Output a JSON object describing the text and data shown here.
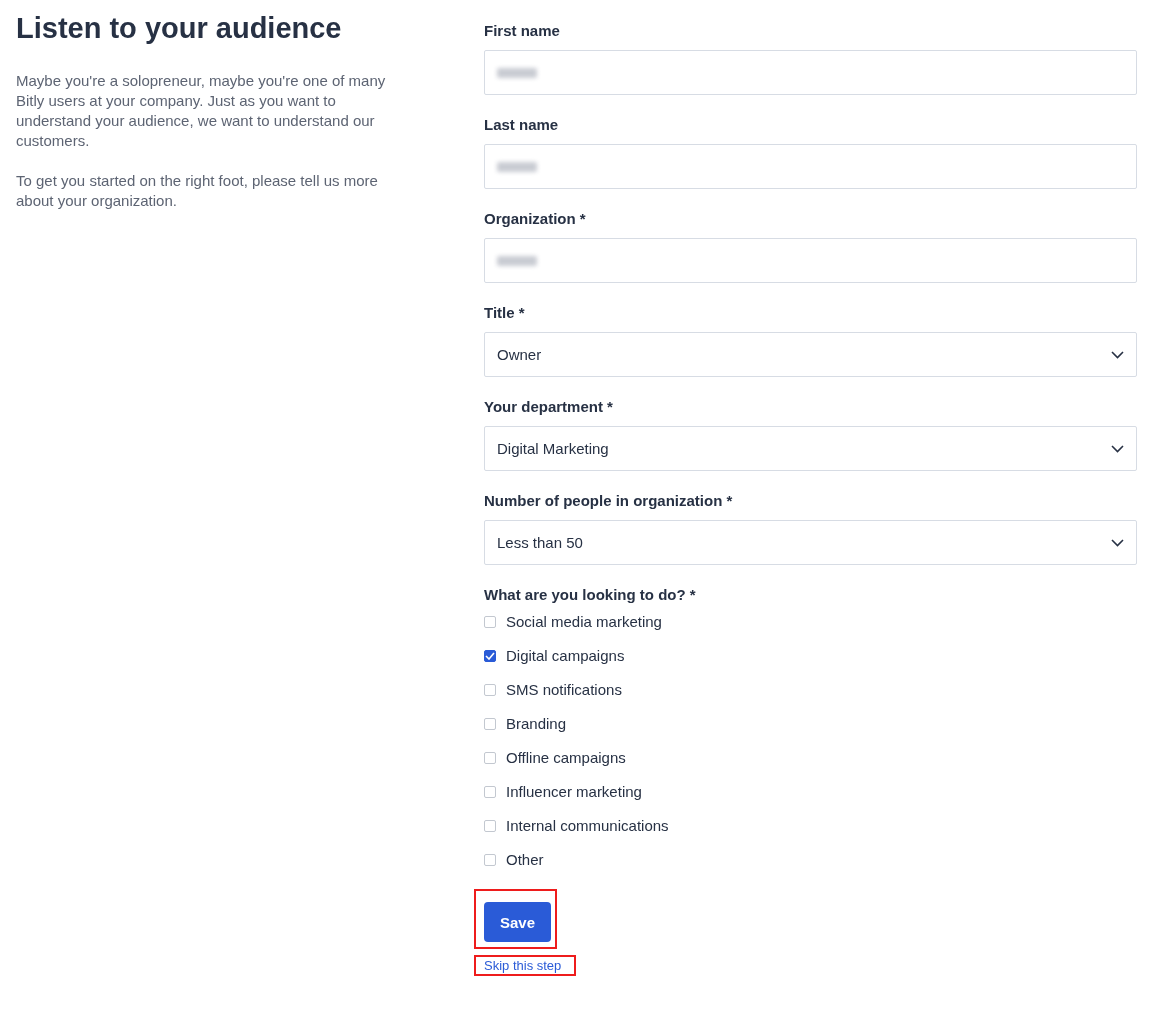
{
  "intro": {
    "title": "Listen to your audience",
    "paragraphs": [
      "Maybe you're a solopreneur, maybe you're one of many Bitly users at your company. Just as you want to understand your audience, we want to understand our customers.",
      "To get you started on the right foot, please tell us more about your organization."
    ]
  },
  "fields": [
    {
      "kind": "text",
      "label": "First name",
      "blurred": true
    },
    {
      "kind": "text",
      "label": "Last name",
      "blurred": true
    },
    {
      "kind": "text",
      "label": "Organization *",
      "blurred": true
    },
    {
      "kind": "select",
      "label": "Title *",
      "value": "Owner"
    },
    {
      "kind": "select",
      "label": "Your department *",
      "value": "Digital Marketing"
    },
    {
      "kind": "select",
      "label": "Number of people in organization *",
      "value": "Less than 50"
    }
  ],
  "goals": {
    "label": "What are you looking to do? *",
    "options": [
      {
        "label": "Social media marketing",
        "checked": false
      },
      {
        "label": "Digital campaigns",
        "checked": true
      },
      {
        "label": "SMS notifications",
        "checked": false
      },
      {
        "label": "Branding",
        "checked": false
      },
      {
        "label": "Offline campaigns",
        "checked": false
      },
      {
        "label": "Influencer marketing",
        "checked": false
      },
      {
        "label": "Internal communications",
        "checked": false
      },
      {
        "label": "Other",
        "checked": false
      }
    ]
  },
  "save_button": {
    "label": "Save",
    "highlighted": true
  },
  "skip_link": {
    "label": "Skip this step",
    "highlighted": true
  }
}
